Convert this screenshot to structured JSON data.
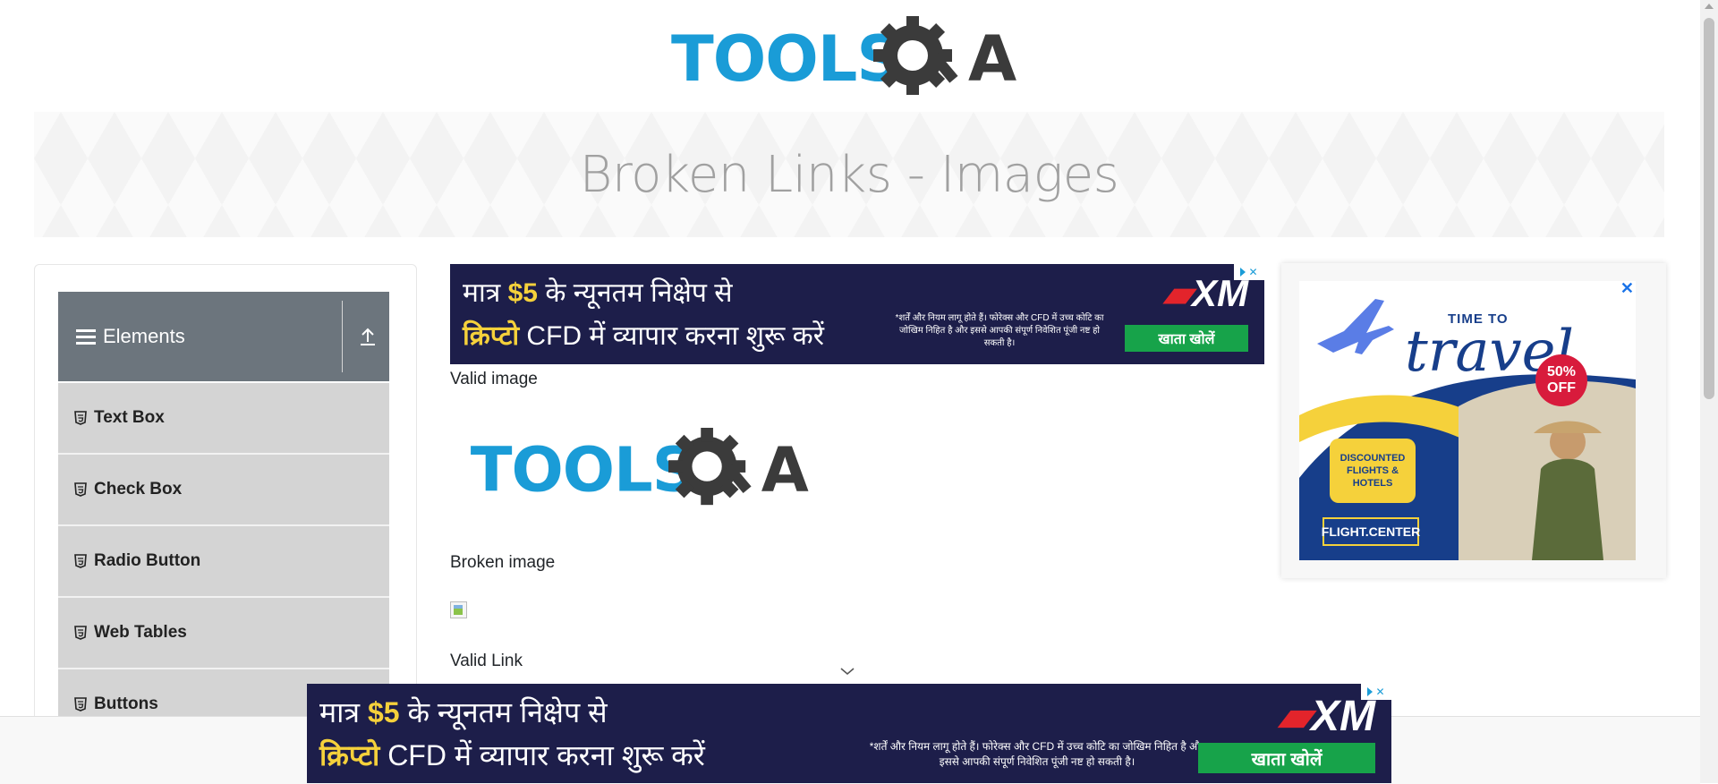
{
  "header": {
    "logo_text": "TOOLS",
    "logo_suffix": "A",
    "logo_alt": "TOOLSQA"
  },
  "banner": {
    "title": "Broken Links - Images"
  },
  "sidebar": {
    "group": {
      "label": "Elements"
    },
    "items": [
      {
        "label": "Text Box"
      },
      {
        "label": "Check Box"
      },
      {
        "label": "Radio Button"
      },
      {
        "label": "Web Tables"
      },
      {
        "label": "Buttons"
      }
    ]
  },
  "ad_banner": {
    "line1_prefix": "मात्र ",
    "line1_amount": "$5",
    "line1_suffix": " के न्यूनतम निक्षेप से",
    "line2_highlight": "क्रिप्टो",
    "line2_suffix": " CFD में व्यापार करना शुरू करें",
    "brand": "XM",
    "disclaimer_top": "*शर्तें और नियम लागू होते हैं। फोरेक्स और CFD में उच्च कोटि का जोखिम निहित है और इससे आपकी संपूर्ण निवेशित पूंजी नष्ट हो सकती है।",
    "disclaimer_bottom": "*शर्तें और नियम लागू होते हैं। फोरेक्स और CFD में उच्च कोटि का जोखिम निहित है और इससे आपकी संपूर्ण निवेशित पूंजी नष्ट हो सकती है।",
    "cta": "खाता खोलें"
  },
  "content": {
    "valid_image_label": "Valid image",
    "broken_image_label": "Broken image",
    "valid_link_label": "Valid Link"
  },
  "side_ad": {
    "close": "✕",
    "title_small": "TIME TO",
    "title_large": "travel",
    "discount": "50% OFF",
    "card_text": "DISCOUNTED FLIGHTS & HOTELS",
    "brand": "FLIGHT.CENTER"
  },
  "colors": {
    "logo_blue": "#1a9cd7",
    "logo_dark": "#3b3b3b",
    "sidebar_header": "#6c757d",
    "sidebar_item": "#d4d4d4",
    "ad_bg": "#1d1e4a",
    "ad_accent": "#f5d13b",
    "cta_green": "#17a34a"
  }
}
